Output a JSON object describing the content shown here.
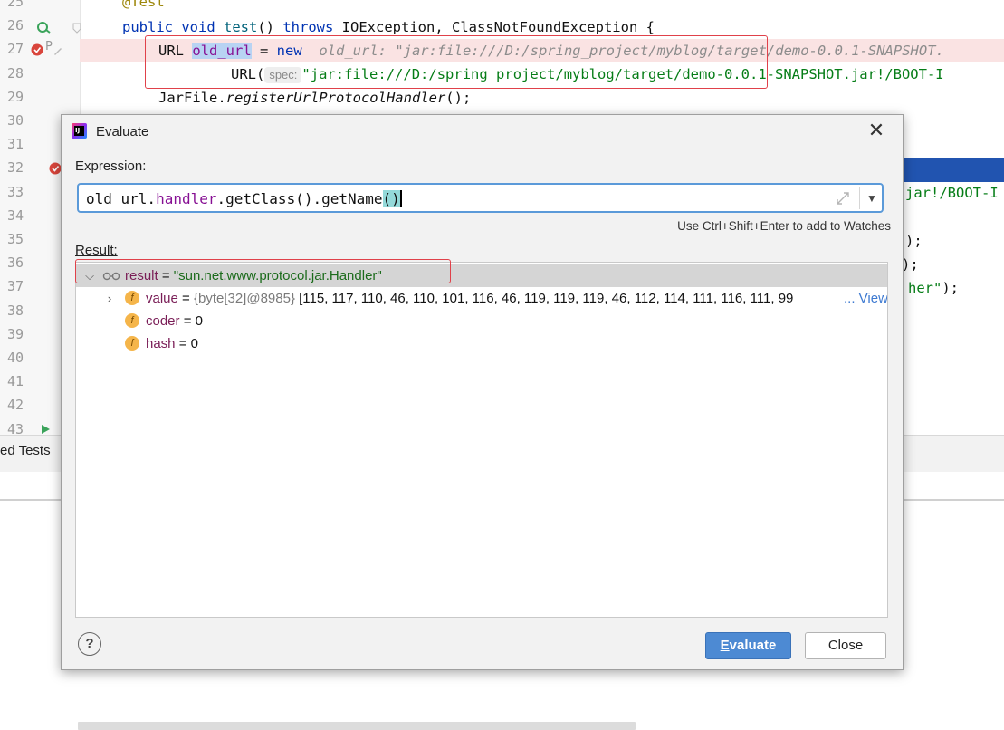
{
  "editor": {
    "line_numbers": [
      "25",
      "26",
      "27",
      "28",
      "29",
      "30",
      "31",
      "32",
      "33",
      "34",
      "35",
      "36",
      "37",
      "38",
      "39",
      "40",
      "41",
      "42",
      "43"
    ],
    "line25": "@Test",
    "line26": {
      "kw1": "public",
      "kw2": "void",
      "method": "test",
      "rest1": "() ",
      "kw3": "throws",
      "rest2": " IOException, ClassNotFoundException {"
    },
    "line27": {
      "type": "URL ",
      "var": "old_url",
      "assign": " = ",
      "kw": "new",
      "hint": "old_url: \"jar:file:///D:/spring_project/myblog/target/demo-0.0.1-SNAPSHOT."
    },
    "line28": {
      "call": "URL(",
      "spec": "spec:",
      "str": "\"jar:file:///D:/spring_project/myblog/target/demo-0.0.1-SNAPSHOT.jar!/BOOT-I"
    },
    "line29": {
      "cls": "JarFile.",
      "method": "registerUrlProtocolHandler",
      "rest": "();"
    },
    "line33_tail": "jar!/BOOT-I",
    "line35_tail": ");",
    "line36_tail": ");",
    "line37_tail": "her\");",
    "tests_label": "ed Tests"
  },
  "dialog": {
    "title": "Evaluate",
    "close_symbol": "✕",
    "expression_label": "Expression:",
    "expression": {
      "part1": "old_url.",
      "part2": "handler",
      "part3": ".getClass().getName",
      "part4": "()"
    },
    "watch_hint": "Use Ctrl+Shift+Enter to add to Watches",
    "result_label": "Result:",
    "result": {
      "name": "result",
      "eq": " = ",
      "value": "\"sun.net.www.protocol.jar.Handler\"",
      "children": [
        {
          "name": "value",
          "eq": " = ",
          "type": "{byte[32]@8985} ",
          "value": "[115, 117, 110, 46, 110, 101, 116, 46, 119, 119, 119, 46, 112, 114, 111, 116, 111, 99",
          "link": "... View"
        },
        {
          "name": "coder",
          "eq": " = ",
          "value": "0"
        },
        {
          "name": "hash",
          "eq": " = ",
          "value": "0"
        }
      ]
    },
    "help_symbol": "?",
    "evaluate_button": {
      "underlined": "E",
      "rest": "valuate"
    },
    "close_button": "Close"
  },
  "colors": {
    "accent": "#4d8ad3",
    "highlight_box": "#e0414a",
    "breakpoint_line": "#fae3e3",
    "string_green": "#067d17",
    "keyword_blue": "#0033b3"
  },
  "icons": [
    "rerun-test-icon",
    "breakpoint-icon",
    "run-icon",
    "intellij-logo-icon",
    "close-icon",
    "expand-icon",
    "dropdown-arrow-icon",
    "chevron-right-icon",
    "chevron-down-icon",
    "watch-glasses-icon",
    "field-icon",
    "help-icon"
  ]
}
